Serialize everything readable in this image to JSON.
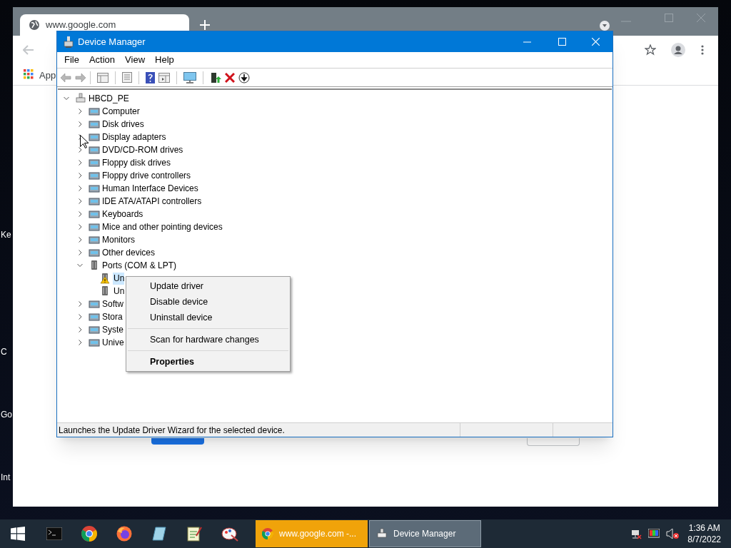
{
  "desktop_labels": [
    "Ke",
    "C",
    "Go",
    "Int"
  ],
  "browser": {
    "tab_title": "www.google.com",
    "bookmark": "App"
  },
  "device_manager": {
    "title": "Device Manager",
    "menu": [
      "File",
      "Action",
      "View",
      "Help"
    ],
    "tree": {
      "label": "HBCD_PE",
      "expanded": true,
      "children": [
        {
          "label": "Computer",
          "expanded": false
        },
        {
          "label": "Disk drives",
          "expanded": false
        },
        {
          "label": "Display adapters",
          "expanded": false
        },
        {
          "label": "DVD/CD-ROM drives",
          "expanded": false
        },
        {
          "label": "Floppy disk drives",
          "expanded": false
        },
        {
          "label": "Floppy drive controllers",
          "expanded": false
        },
        {
          "label": "Human Interface Devices",
          "expanded": false
        },
        {
          "label": "IDE ATA/ATAPI controllers",
          "expanded": false
        },
        {
          "label": "Keyboards",
          "expanded": false
        },
        {
          "label": "Mice and other pointing devices",
          "expanded": false
        },
        {
          "label": "Monitors",
          "expanded": false
        },
        {
          "label": "Other devices",
          "expanded": false
        },
        {
          "label": "Ports (COM & LPT)",
          "expanded": true,
          "children": [
            {
              "label": "Un",
              "selected": true,
              "warning": true
            },
            {
              "label": "Un",
              "selected": false,
              "warning": false
            }
          ]
        },
        {
          "label": "Softw",
          "expanded": false
        },
        {
          "label": "Stora",
          "expanded": false
        },
        {
          "label": "Syste",
          "expanded": false
        },
        {
          "label": "Unive",
          "expanded": false
        }
      ]
    },
    "status_text": "Launches the Update Driver Wizard for the selected device."
  },
  "context_menu": [
    {
      "kind": "item",
      "label": "Update driver",
      "default": false
    },
    {
      "kind": "item",
      "label": "Disable device",
      "default": false
    },
    {
      "kind": "item",
      "label": "Uninstall device",
      "default": false
    },
    {
      "kind": "separator"
    },
    {
      "kind": "item",
      "label": "Scan for hardware changes",
      "default": false
    },
    {
      "kind": "separator"
    },
    {
      "kind": "item",
      "label": "Properties",
      "default": true
    }
  ],
  "taskbar": {
    "tasks": [
      {
        "label": "www.google.com -...",
        "flashing": true,
        "selected": false
      },
      {
        "label": "Device Manager",
        "flashing": false,
        "selected": true
      }
    ],
    "time": "1:36 AM",
    "date": "8/7/2022"
  }
}
